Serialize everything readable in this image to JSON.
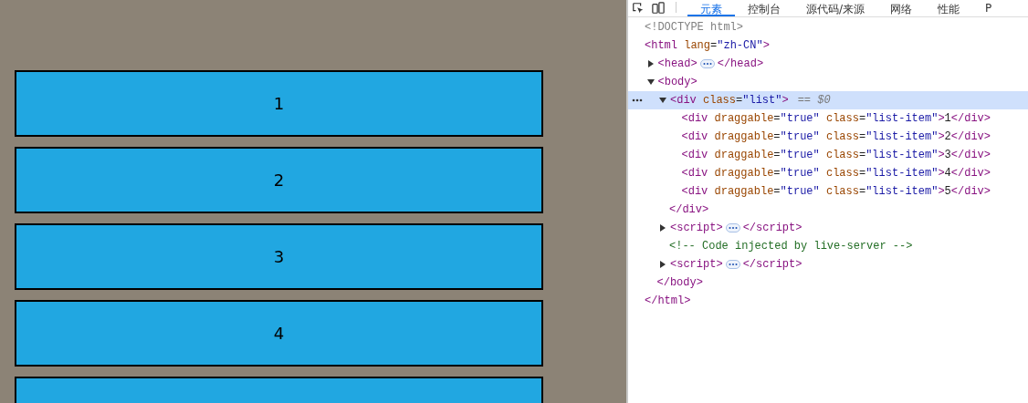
{
  "page": {
    "items": [
      {
        "kind": "full",
        "label": "1"
      },
      {
        "kind": "full",
        "label": "2"
      },
      {
        "kind": "full",
        "label": "3"
      },
      {
        "kind": "full",
        "label": "4"
      },
      {
        "kind": "cut"
      }
    ]
  },
  "devtools": {
    "tabs": [
      {
        "label": "元素",
        "selected": true
      },
      {
        "label": "控制台",
        "selected": false
      },
      {
        "label": "源代码/来源",
        "selected": false
      },
      {
        "label": "网络",
        "selected": false
      },
      {
        "label": "性能",
        "selected": false
      },
      {
        "label": "P",
        "selected": false
      }
    ],
    "dom_tree": [
      {
        "kind": "doctype",
        "text": "<!DOCTYPE html>",
        "selected": false
      },
      {
        "kind": "element",
        "text": "<html lang=\"zh-CN\">",
        "close": "</html>",
        "selected": false,
        "children": [
          {
            "kind": "element",
            "text": "<head>",
            "close": "</head>",
            "expanded": false,
            "selected": false
          },
          {
            "kind": "element",
            "text": "<body>",
            "close": "</body>",
            "expanded": true,
            "selected": false,
            "children": [
              {
                "kind": "element",
                "text": "<div class=\"list\">",
                "close": "</div>",
                "expanded": true,
                "selected": true,
                "note": "== $0",
                "children": [
                  {
                    "kind": "element",
                    "text": "<div draggable=\"true\" class=\"list-item\">1</div>",
                    "selected": false
                  },
                  {
                    "kind": "element",
                    "text": "<div draggable=\"true\" class=\"list-item\">2</div>",
                    "selected": false
                  },
                  {
                    "kind": "element",
                    "text": "<div draggable=\"true\" class=\"list-item\">3</div>",
                    "selected": false
                  },
                  {
                    "kind": "element",
                    "text": "<div draggable=\"true\" class=\"list-item\">4</div>",
                    "selected": false
                  },
                  {
                    "kind": "element",
                    "text": "<div draggable=\"true\" class=\"list-item\">5</div>",
                    "selected": false
                  }
                ]
              },
              {
                "kind": "element",
                "text": "<script>",
                "close": "</script>",
                "expanded": false,
                "selected": false
              },
              {
                "kind": "comment",
                "text": "<!-- Code injected by live-server -->",
                "selected": false
              },
              {
                "kind": "element",
                "text": "<script>",
                "close": "</script>",
                "expanded": false,
                "selected": false
              }
            ]
          }
        ]
      }
    ]
  }
}
